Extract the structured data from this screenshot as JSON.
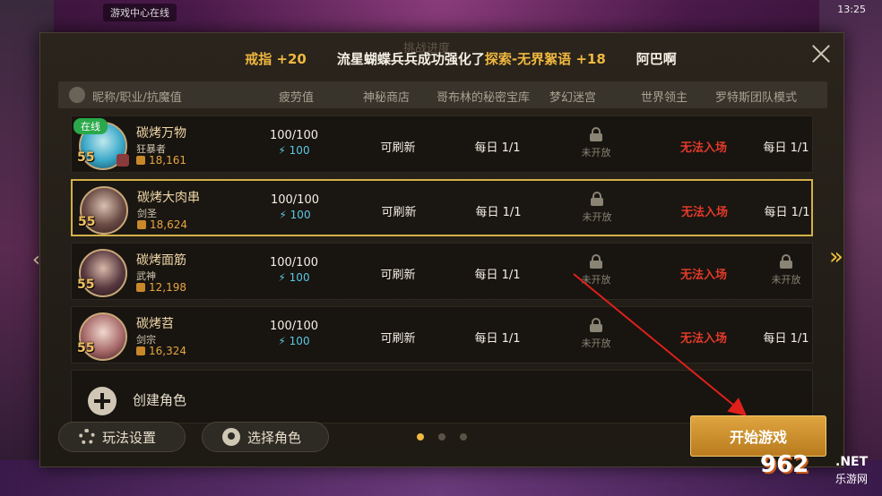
{
  "background": {
    "status_text": "游戏中心在线"
  },
  "system": {
    "time": "13:25"
  },
  "notice": {
    "item1": "戒指 +20",
    "item2_prefix": "流星蝴蝶兵兵成功强化了",
    "item2_gold": "探索-无界絮语 +18",
    "item3": "阿巴啊"
  },
  "panel_title": "挑战进度",
  "header": {
    "name_col": "昵称/职业/抗魔值",
    "fatigue": "疲劳值",
    "shop": "神秘商店",
    "goblin": "哥布林的秘密宝库",
    "maze": "梦幻迷宫",
    "boss": "世界领主",
    "lotus": "罗特斯团队模式"
  },
  "characters": [
    {
      "name": "碳烤万物",
      "job": "狂暴者",
      "power": "18,161",
      "level": "55",
      "online": "在线",
      "fatigue": "100/100",
      "fatigue_sub": "100",
      "shop": "可刷新",
      "goblin": "每日 1/1",
      "maze": "未开放",
      "boss": "无法入场",
      "lotus": "每日 1/1"
    },
    {
      "name": "碳烤大肉串",
      "job": "剑圣",
      "power": "18,624",
      "level": "55",
      "fatigue": "100/100",
      "fatigue_sub": "100",
      "shop": "可刷新",
      "goblin": "每日 1/1",
      "maze": "未开放",
      "boss": "无法入场",
      "lotus": "每日 1/1"
    },
    {
      "name": "碳烤面筋",
      "job": "武神",
      "power": "12,198",
      "level": "55",
      "fatigue": "100/100",
      "fatigue_sub": "100",
      "shop": "可刷新",
      "goblin": "每日 1/1",
      "maze": "未开放",
      "boss": "无法入场",
      "lotus": "未开放"
    },
    {
      "name": "碳烤苕",
      "job": "剑宗",
      "power": "16,324",
      "level": "55",
      "fatigue": "100/100",
      "fatigue_sub": "100",
      "shop": "可刷新",
      "goblin": "每日 1/1",
      "maze": "未开放",
      "boss": "无法入场",
      "lotus": "每日 1/1"
    }
  ],
  "create": {
    "label": "创建角色"
  },
  "buttons": {
    "settings": "玩法设置",
    "select": "选择角色",
    "start": "开始游戏"
  },
  "pagination": {
    "current": 1,
    "total": 3
  },
  "watermark": {
    "number": "962",
    "net": ".NET",
    "sub": "乐游网"
  },
  "colors": {
    "gold": "#f0b840",
    "red_status": "#e23a2a",
    "fatigue_blue": "#5ac8e0",
    "start_btn": "#d89a36",
    "selected_border": "#d4b04a"
  }
}
